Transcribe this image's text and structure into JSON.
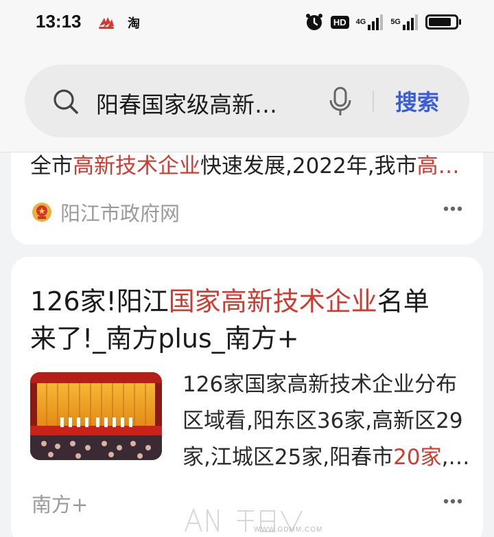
{
  "status_bar": {
    "time": "13:13",
    "app_icons": [
      "poker-app-icon",
      "taobao-icon"
    ],
    "taobao_label": "淘",
    "hd_label": "HD",
    "net1": "4G",
    "net2": "5G"
  },
  "search": {
    "query": "阳春国家级高新…",
    "button_label": "搜索"
  },
  "results": [
    {
      "snippet_parts": [
        "全市",
        "高新技术企业",
        "快速发展,2022年,我市",
        "高…"
      ],
      "source": "阳江市政府网"
    },
    {
      "title_parts": [
        "126家!阳江",
        "国家高新技术企业",
        "名单"
      ],
      "title_line2": "来了!_南方plus_南方+",
      "desc_line1": "126家国家高新技术企业分布",
      "desc_line2": "区域看,阳东区36家,高新区29",
      "desc_line3_parts": [
        "家,江城区25家,阳春市",
        "20家",
        ",…"
      ],
      "source": "南方+"
    }
  ],
  "watermark": {
    "url": "WWW.GDMM.COM"
  },
  "colors": {
    "highlight": "#d33a2f",
    "search_button": "#3b5cd9",
    "background": "#f2f3f5"
  }
}
